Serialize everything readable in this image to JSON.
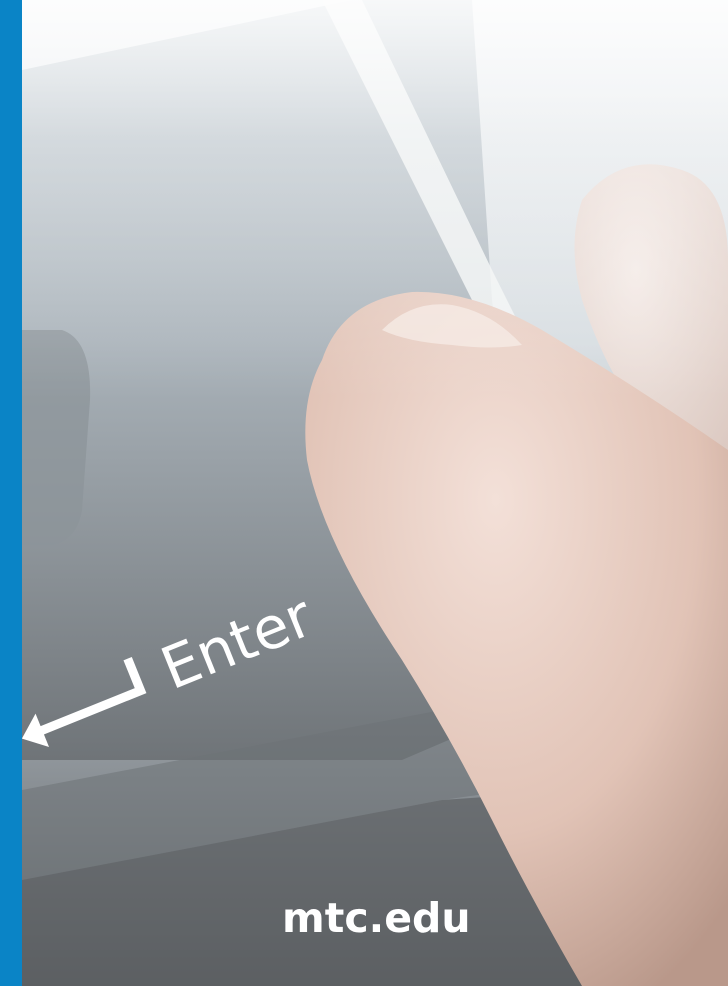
{
  "key_label": "Enter",
  "footer": {
    "domain": "mtc.edu"
  },
  "colors": {
    "accent_bar": "#0a84c6",
    "footer_text": "#ffffff"
  },
  "icons": {
    "enter_arrow": "return-arrow-icon"
  }
}
